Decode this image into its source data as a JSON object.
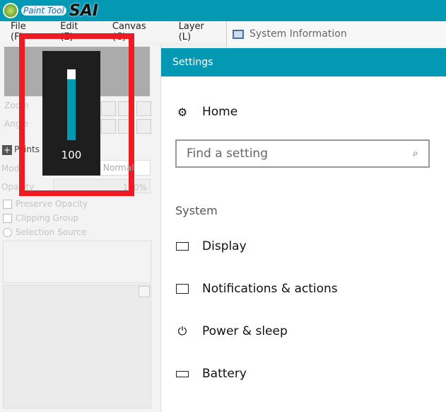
{
  "app": {
    "logo_small": "Paint Tool",
    "logo_big": "SAI"
  },
  "menu": [
    "File (F)",
    "Edit (E)",
    "Canvas (C)",
    "Layer (L)"
  ],
  "taskbar_window": {
    "title": "System Information"
  },
  "left_panel": {
    "zoom_label": "Zoom",
    "angle_label": "Angle",
    "paint_effects": "Paints Effect",
    "mode_label": "Mode",
    "mode_value": "Normal",
    "opacity_label": "Opacity",
    "opacity_value": "100%",
    "preserve_opacity": "Preserve Opacity",
    "clipping_group": "Clipping Group",
    "selection_source": "Selection Source"
  },
  "volume": {
    "value": "100",
    "level_percent": 100
  },
  "settings": {
    "title": "Settings",
    "home": "Home",
    "search_placeholder": "Find a setting",
    "section": "System",
    "items": [
      {
        "label": "Display",
        "icon": "monitor-icon"
      },
      {
        "label": "Notifications & actions",
        "icon": "notification-icon"
      },
      {
        "label": "Power & sleep",
        "icon": "power-icon"
      },
      {
        "label": "Battery",
        "icon": "battery-icon"
      }
    ]
  },
  "colors": {
    "accent": "#0399b5",
    "highlight": "#ed1c24"
  }
}
